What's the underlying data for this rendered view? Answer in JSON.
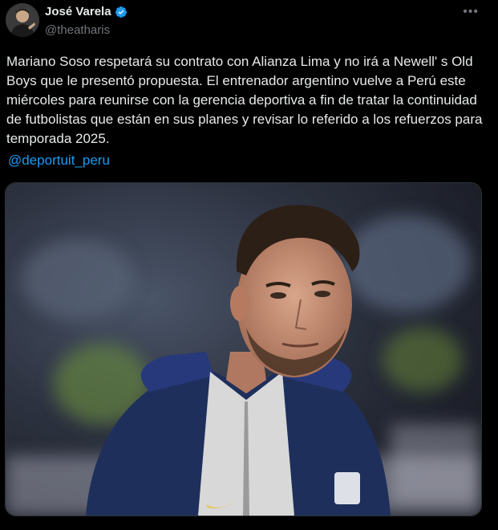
{
  "author": {
    "name": "José Varela",
    "handle": "@theatharis",
    "verified": true
  },
  "icons": {
    "verified": "verified-badge-icon",
    "more": "more-options-icon"
  },
  "tweet": {
    "text": "Mariano Soso respetará su contrato con Alianza Lima y no irá a Newell' s Old Boys que le presentó propuesta. El entrenador argentino vuelve a Perú este miércoles para reunirse con la gerencia deportiva a fin de tratar la continuidad de futbolistas que están en sus planes y revisar lo referido a los refuerzos para temporada 2025.",
    "mention": "@deportuit_peru"
  },
  "colors": {
    "background": "#000000",
    "text": "#e7e9ea",
    "muted": "#71767b",
    "link": "#1d9bf0",
    "verified": "#1d9bf0"
  }
}
